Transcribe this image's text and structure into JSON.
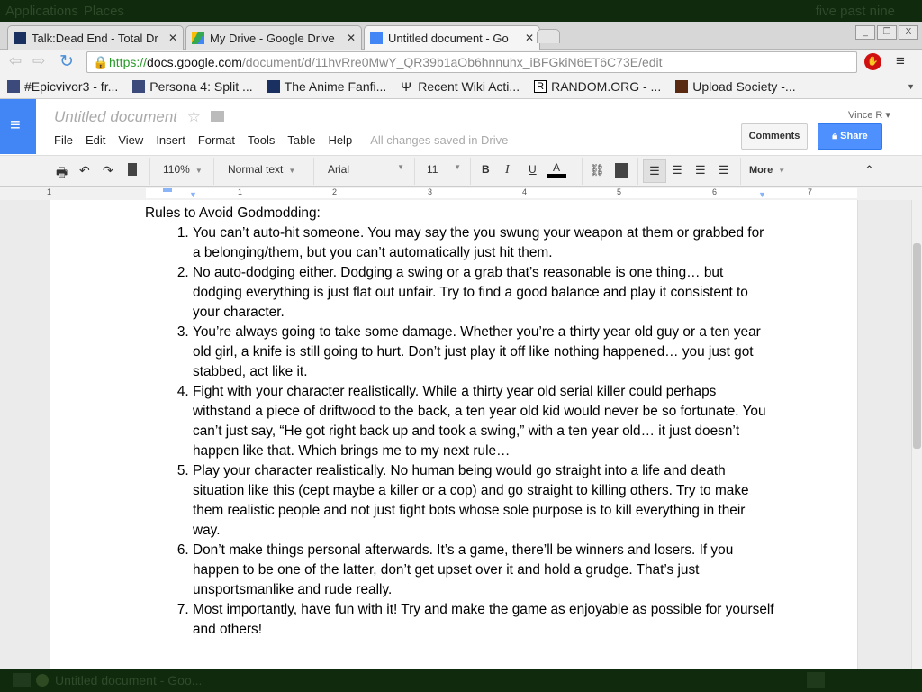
{
  "panel": {
    "applications": "Applications",
    "places": "Places",
    "clock": "five past nine"
  },
  "browser": {
    "tabs": [
      {
        "title": "Talk:Dead End - Total Dr"
      },
      {
        "title": "My Drive - Google Drive"
      },
      {
        "title": "Untitled document - Go"
      }
    ],
    "url_scheme": "https://",
    "url_host": "docs.google.com",
    "url_path": "/document/d/11hvRre0MwY_QR39b1aOb6hnnuhx_iBFGkiN6ET6C73E/edit",
    "bookmarks": [
      "#Epicvivor3 - fr...",
      "Persona 4: Split ...",
      "The Anime Fanfi...",
      "Recent Wiki Acti...",
      "RANDOM.ORG - ...",
      "Upload Society -..."
    ]
  },
  "docs": {
    "title": "Untitled document",
    "user": "Vince R",
    "menu": [
      "File",
      "Edit",
      "View",
      "Insert",
      "Format",
      "Tools",
      "Table",
      "Help"
    ],
    "saved_status": "All changes saved in Drive",
    "comments_label": "Comments",
    "share_label": "Share",
    "toolbar": {
      "zoom": "110%",
      "style": "Normal text",
      "font": "Arial",
      "size": "11",
      "bold": "B",
      "italic": "I",
      "underline": "U",
      "text_color": "A",
      "more": "More"
    },
    "ruler": [
      "1",
      "1",
      "2",
      "3",
      "4",
      "5",
      "6",
      "7"
    ]
  },
  "document": {
    "heading": "Rules to Avoid Godmodding:",
    "rules": [
      "You can’t auto-hit someone.  You may say the you swung your weapon at them or grabbed for a belonging/them, but you can’t automatically just hit them.",
      "No auto-dodging either.  Dodging a swing or a grab that’s reasonable is one thing… but dodging everything is just flat out unfair.  Try to find a good balance and play it consistent to your character.",
      "You’re always going to take some damage.  Whether you’re a thirty year old guy or a ten year old girl, a knife is still going to hurt.  Don’t just play it off like nothing happened… you just got stabbed, act like it.",
      "Fight with your character realistically.  While a thirty year old serial killer could perhaps withstand a piece of driftwood to the back, a ten year old kid would never be so fortunate.  You can’t just say, “He got right back up and took a swing,” with a ten year old… it just doesn’t happen like that.  Which brings me to my next rule…",
      "Play your character realistically.  No human being would go straight into a life and death situation like this (cept maybe a killer or a cop) and go straight to killing others.  Try to make them realistic people and not just fight bots whose sole purpose is to kill everything in their way.",
      "Don’t make things personal afterwards.  It’s a game, there’ll be winners and losers.  If you happen to be one of the latter, don’t get upset over it and hold a grudge.  That’s just unsportsmanlike and rude really.",
      "Most importantly, have fun with it!  Try and make the game as enjoyable as possible for yourself and others!"
    ]
  },
  "taskbar": {
    "window": "Untitled document - Goo..."
  }
}
